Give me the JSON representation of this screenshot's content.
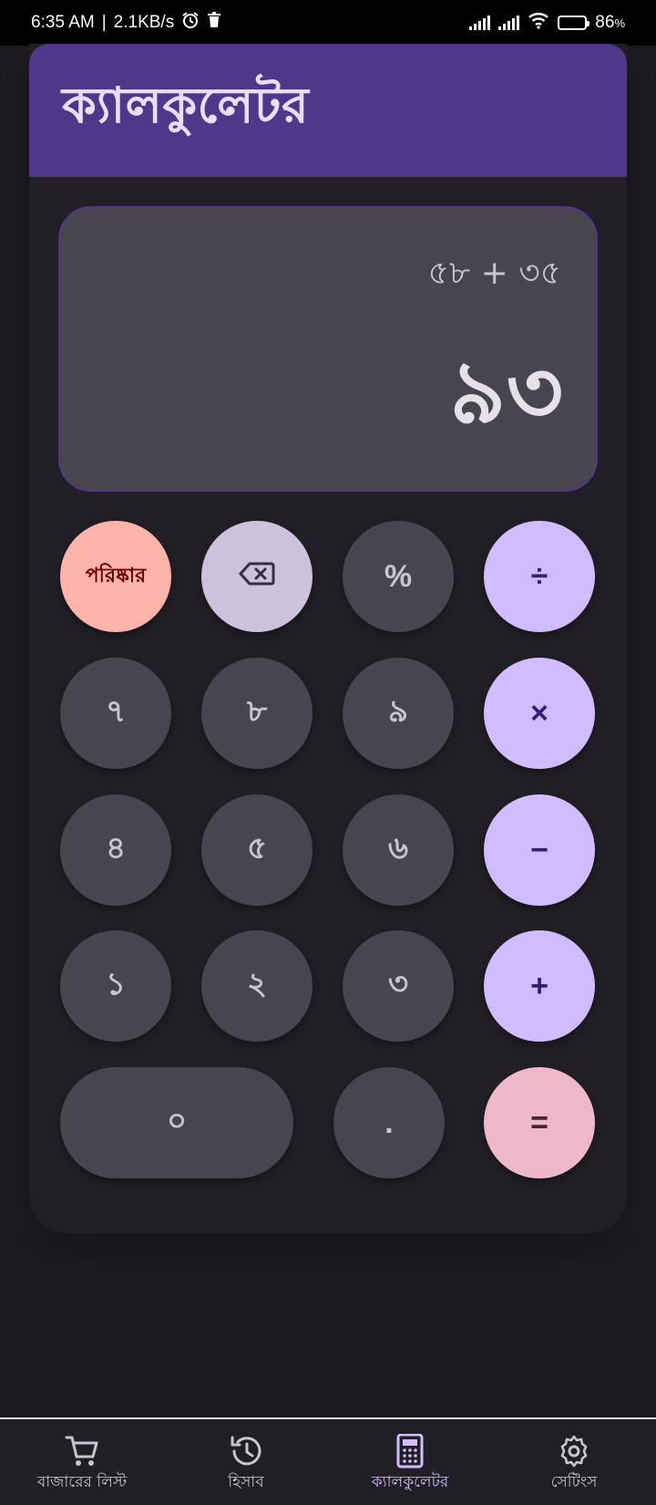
{
  "status_bar": {
    "time": "6:35 AM",
    "speed": "2.1KB/s",
    "battery": "86",
    "battery_unit": "%",
    "battery_level": 0.86
  },
  "app": {
    "title": "ক্যালকুলেটর"
  },
  "display": {
    "expression": "৫৮ + ৩৫",
    "result": "৯৩"
  },
  "keys": {
    "clear": "পরিষ্কার",
    "percent": "%",
    "divide": "÷",
    "seven": "৭",
    "eight": "৮",
    "nine": "৯",
    "multiply": "×",
    "four": "৪",
    "five": "৫",
    "six": "৬",
    "minus": "−",
    "one": "১",
    "two": "২",
    "three": "৩",
    "plus": "+",
    "zero": "০",
    "dot": ".",
    "equals": "="
  },
  "nav": {
    "items": [
      {
        "label": "বাজারের লিস্ট",
        "icon": "cart-icon"
      },
      {
        "label": "হিসাব",
        "icon": "history-icon"
      },
      {
        "label": "ক্যালকুলেটর",
        "icon": "calculator-icon"
      },
      {
        "label": "সেটিংস",
        "icon": "gear-icon"
      }
    ],
    "active_index": 2
  },
  "colors": {
    "header": "#4f378a",
    "operator": "#d0bcff",
    "clear": "#ffb4ab",
    "equals": "#efb8c8",
    "number": "#49454f"
  }
}
